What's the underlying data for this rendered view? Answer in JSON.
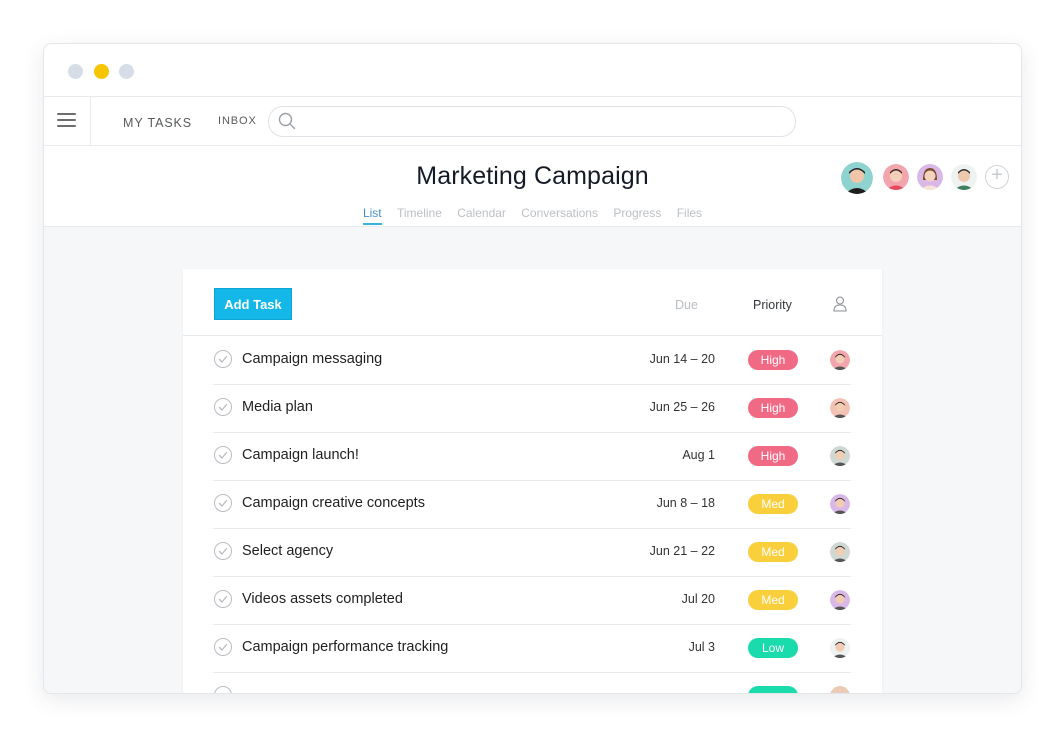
{
  "window": {
    "dots": [
      "close",
      "minimize",
      "maximize"
    ]
  },
  "topnav": {
    "menu_icon": "hamburger-icon",
    "my_tasks": "MY TASKS",
    "inbox": "INBOX",
    "search": {
      "icon": "search-icon",
      "placeholder": "",
      "value": ""
    }
  },
  "project": {
    "title": "Marketing Campaign",
    "tabs": [
      "List",
      "Timeline",
      "Calendar",
      "Conversations",
      "Progress",
      "Files"
    ],
    "active_tab": "List",
    "add_member_icon": "plus-icon"
  },
  "list": {
    "add_task_label": "Add Task",
    "col_due": "Due",
    "col_priority": "Priority",
    "col_assignee_icon": "person-icon",
    "tasks": [
      {
        "name": "Campaign messaging",
        "due": "Jun 14 – 20",
        "priority": "High"
      },
      {
        "name": "Media plan",
        "due": "Jun 25 – 26",
        "priority": "High"
      },
      {
        "name": "Campaign launch!",
        "due": "Aug 1",
        "priority": "High"
      },
      {
        "name": "Campaign creative concepts",
        "due": "Jun 8 – 18",
        "priority": "Med"
      },
      {
        "name": "Select agency",
        "due": "Jun 21 – 22",
        "priority": "Med"
      },
      {
        "name": "Videos assets completed",
        "due": "Jul 20",
        "priority": "Med"
      },
      {
        "name": "Campaign performance tracking",
        "due": "Jul 3",
        "priority": "Low"
      }
    ]
  },
  "colors": {
    "accent": "#14b8e8",
    "high": "#f06a85",
    "med": "#f9cf3c",
    "low": "#19dbab",
    "dot_yellow": "#f7c500"
  }
}
